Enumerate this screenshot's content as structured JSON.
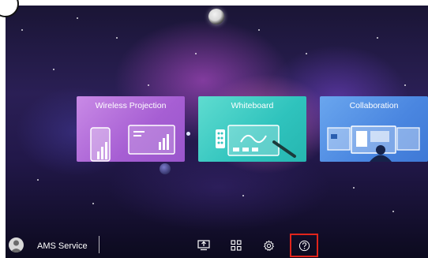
{
  "screen": {
    "cards": [
      {
        "id": "wireless",
        "title": "Wireless Projection",
        "icon": "wireless-projection-icon",
        "color": "#a65ed3"
      },
      {
        "id": "whiteboard",
        "title": "Whiteboard",
        "icon": "whiteboard-icon",
        "color": "#2fc3bd"
      },
      {
        "id": "collab",
        "title": "Collaboration",
        "icon": "collaboration-icon",
        "color": "#4a86e0"
      }
    ]
  },
  "bottom_bar": {
    "user": {
      "name": "AMS Service",
      "icon": "user-avatar-icon"
    },
    "dock": [
      {
        "id": "screen-share",
        "icon": "screen-share-icon"
      },
      {
        "id": "apps",
        "icon": "apps-grid-icon"
      },
      {
        "id": "settings",
        "icon": "gear-icon"
      },
      {
        "id": "help",
        "icon": "help-icon",
        "highlighted": true,
        "highlight_color": "#e0241b"
      }
    ]
  }
}
